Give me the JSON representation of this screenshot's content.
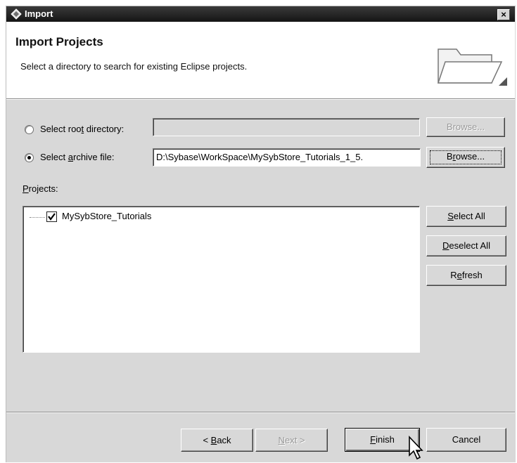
{
  "window": {
    "title": "Import",
    "close_glyph": "×"
  },
  "header": {
    "title": "Import Projects",
    "description": "Select a directory to search for existing Eclipse projects.",
    "icon": "folder-icon"
  },
  "source": {
    "root_directory": {
      "label_pre": "Select roo",
      "label_key": "t",
      "label_post": " directory:",
      "selected": false,
      "value": ""
    },
    "archive_file": {
      "label_pre": "Select ",
      "label_key": "a",
      "label_post": "rchive file:",
      "selected": true,
      "value": "D:\\Sybase\\WorkSpace\\MySybStore_Tutorials_1_5."
    },
    "browse_root_label": "Browse...",
    "browse_archive": {
      "key": "r",
      "rest_pre": "B",
      "rest_post": "owse..."
    }
  },
  "projects": {
    "label_key": "P",
    "label_rest": "rojects:",
    "items": [
      {
        "name": "MySybStore_Tutorials",
        "checked": true
      }
    ]
  },
  "side_buttons": {
    "select_all": {
      "key": "S",
      "rest": "elect All"
    },
    "deselect_all": {
      "key": "D",
      "rest": "eselect All"
    },
    "refresh": {
      "pre": "R",
      "key": "e",
      "post": "fresh"
    }
  },
  "footer": {
    "back": {
      "pre": "< ",
      "key": "B",
      "post": "ack"
    },
    "next": {
      "key": "N",
      "post": "ext >"
    },
    "finish": {
      "key": "F",
      "post": "inish"
    },
    "cancel": "Cancel"
  }
}
